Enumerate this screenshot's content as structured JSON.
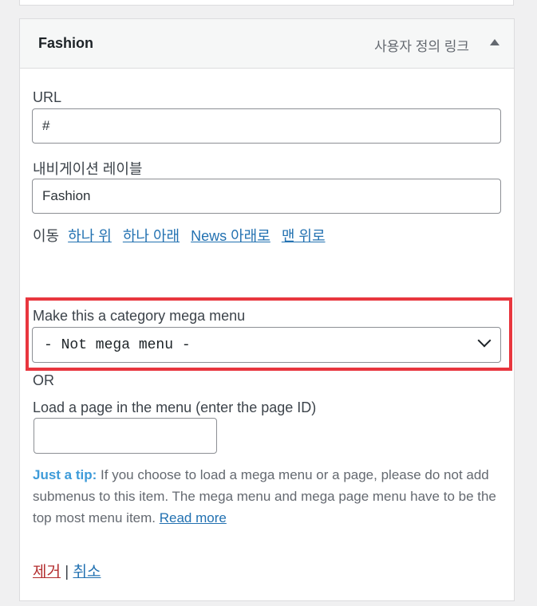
{
  "menu_item": {
    "title": "Fashion",
    "type_label": "사용자 정의 링크",
    "toggle_icon": "triangle-up-icon"
  },
  "url": {
    "label": "URL",
    "value": "#"
  },
  "nav_label": {
    "label": "내비게이션 레이블",
    "value": "Fashion"
  },
  "move": {
    "label": "이동",
    "links": [
      "하나 위",
      "하나 아래",
      "News 아래로",
      "맨 위로"
    ]
  },
  "mega": {
    "label": "Make this a category mega menu",
    "selected": "- Not mega menu -",
    "highlight_color": "#e8363e"
  },
  "or_text": "OR",
  "page_id": {
    "label": "Load a page in the menu (enter the page ID)",
    "value": ""
  },
  "tip": {
    "strong": "Just a tip:",
    "text": " If you choose to load a mega menu or a page, please do not add submenus to this item. The mega menu and mega page menu have to be the top most menu item. ",
    "link": "Read more"
  },
  "actions": {
    "remove": "제거",
    "separator": "|",
    "cancel": "취소"
  }
}
